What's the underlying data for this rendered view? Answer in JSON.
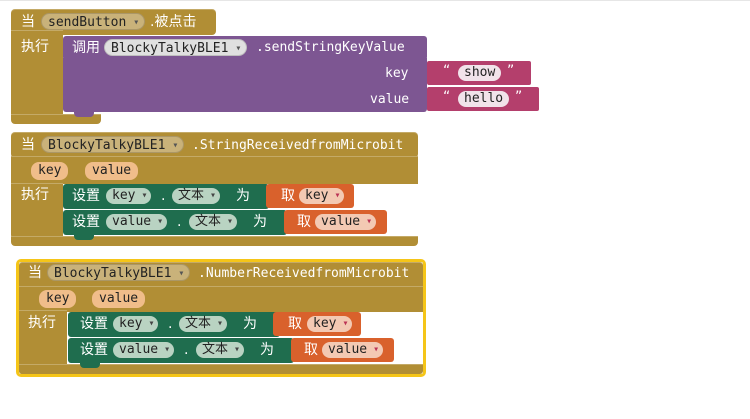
{
  "block1": {
    "when": "当",
    "component": "sendButton",
    "event": ".被点击",
    "do": "执行",
    "call": "调用",
    "call_component": "BlockyTalkyBLE1",
    "method": ".sendStringKeyValue",
    "param_key_label": "key",
    "param_value_label": "value",
    "quote_open": "“",
    "quote_close": "”",
    "key_value": "show",
    "value_value": "hello"
  },
  "block2": {
    "when": "当",
    "component": "BlockyTalkyBLE1",
    "event": ".StringReceivedfromMicrobit",
    "param1": "key",
    "param2": "value",
    "do": "执行",
    "set": "设置",
    "dot": ".",
    "prop": "文本",
    "to": "为",
    "get": "取",
    "row1_target": "key",
    "row1_get": "key",
    "row2_target": "value",
    "row2_get": "value"
  },
  "block3": {
    "when": "当",
    "component": "BlockyTalkyBLE1",
    "event": ".NumberReceivedfromMicrobit",
    "param1": "key",
    "param2": "value",
    "do": "执行",
    "set": "设置",
    "dot": ".",
    "prop": "文本",
    "to": "为",
    "get": "取",
    "row1_target": "key",
    "row1_get": "key",
    "row2_target": "value",
    "row2_get": "value"
  },
  "colors": {
    "event": "#b18e35",
    "procedure": "#7d5692",
    "text": "#b43f6c",
    "setter": "#1f6d4e",
    "getter": "#d9612c",
    "selection": "#f5c518"
  }
}
